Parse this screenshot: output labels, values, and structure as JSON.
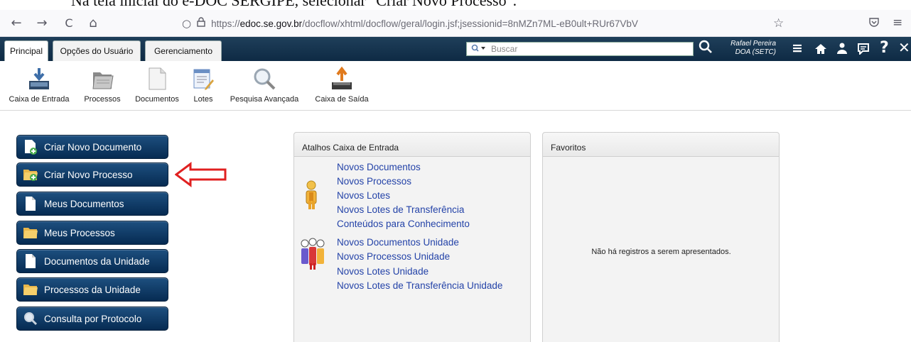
{
  "doc_caption": "Na tela inicial do e-DOC SERGIPE, selecionar \"Criar Novo Processo\".",
  "browser": {
    "back": "←",
    "forward": "→",
    "reload": "C",
    "home": "⌂",
    "url_prefix": "https://",
    "url_domain": "edoc.se.gov.br",
    "url_path": "/docflow/xhtml/docflow/geral/login.jsf;jsessionid=8nMZn7ML-eB0ult+RUr67VbV"
  },
  "header": {
    "tabs": [
      "Principal",
      "Opções do Usuário",
      "Gerenciamento"
    ],
    "search_placeholder": "Buscar",
    "user_name": "Rafael Pereira",
    "user_unit": "DOA (SETC)"
  },
  "toolbar": {
    "items": [
      "Caixa de Entrada",
      "Processos",
      "Documentos",
      "Lotes",
      "Pesquisa Avançada",
      "Caixa de Saída"
    ]
  },
  "actions": [
    {
      "label": "Criar Novo Documento",
      "icon": "new-document-icon"
    },
    {
      "label": "Criar Novo Processo",
      "icon": "new-process-icon"
    },
    {
      "label": "Meus Documentos",
      "icon": "document-icon"
    },
    {
      "label": "Meus Processos",
      "icon": "folder-icon"
    },
    {
      "label": "Documentos da Unidade",
      "icon": "document-icon"
    },
    {
      "label": "Processos da Unidade",
      "icon": "folder-icon"
    },
    {
      "label": "Consulta por Protocolo",
      "icon": "magnifier-icon"
    }
  ],
  "atalhos": {
    "title": "Atalhos Caixa de Entrada",
    "personal": [
      "Novos Documentos",
      "Novos Processos",
      "Novos Lotes",
      "Novos Lotes de Transferência",
      "Conteúdos para Conhecimento"
    ],
    "unit": [
      "Novos Documentos Unidade",
      "Novos Processos Unidade",
      "Novos Lotes Unidade",
      "Novos Lotes de Transferência Unidade"
    ]
  },
  "favoritos": {
    "title": "Favoritos",
    "empty": "Não há registros a serem apresentados."
  },
  "colors": {
    "header_bg": "#0e2a44",
    "button_bg": "#062b52",
    "link": "#2443a8",
    "annotation_arrow": "#e02020"
  }
}
